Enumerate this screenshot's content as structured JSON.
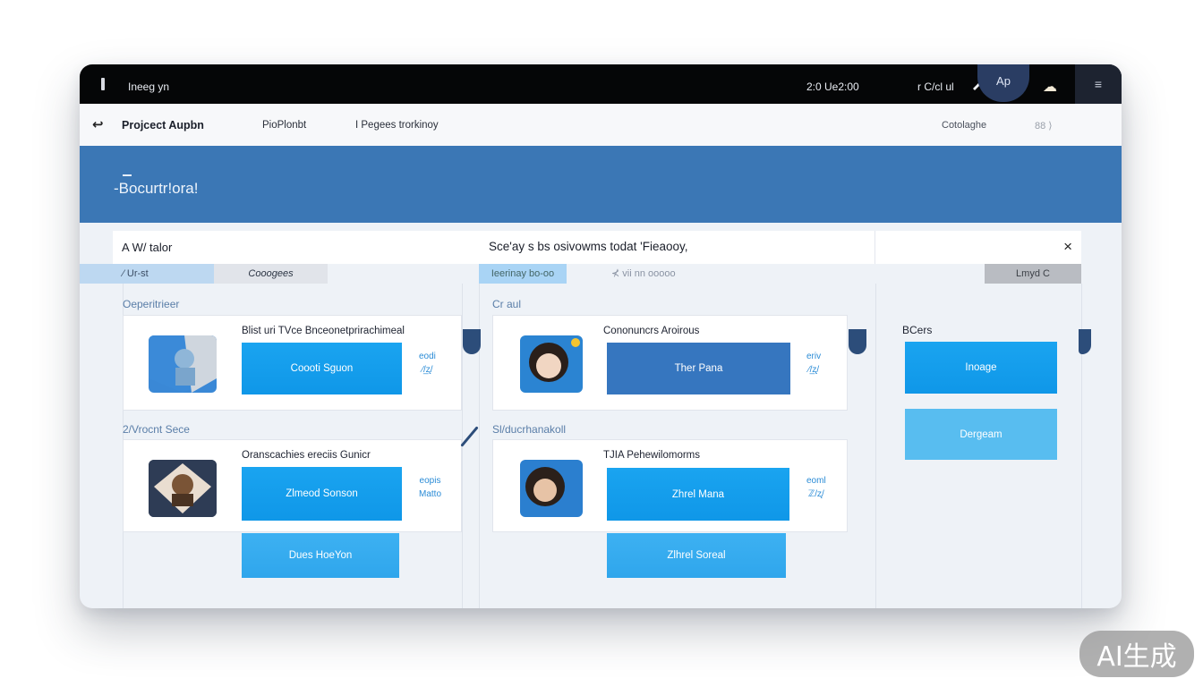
{
  "system_bar": {
    "app_name": "Ineeg yn",
    "clock": "2:0 Ue2:00",
    "status": "r C/cl ul",
    "avatar_label": "Ap",
    "menu_icon": "≡"
  },
  "nav": {
    "back_icon": "arrow-left-icon",
    "project": "Projcect Aupbn",
    "items": [
      "PioPlonbt",
      "I Pegees trorkinoy"
    ],
    "right_items": [
      "Cotolaghe",
      "88 ⟩"
    ]
  },
  "banner": {
    "title": "-Bocurtr!ora!"
  },
  "panel": {
    "left_label": "A W/ talor",
    "mid_label": "Sce'ay s bs osivowms todat 'Fieaooy,",
    "close_label": "×",
    "filters": [
      "⁄ Ur-st",
      "Cooogees",
      "Ieerinay bo-oo",
      "⊀ vii nn ooooo",
      "Lmyd C"
    ]
  },
  "columns": [
    {
      "sections": [
        {
          "label": "Oeperitrieer",
          "card": {
            "title": "Blist uri TVce Bnceonetprirachimeal",
            "button": "Coooti Sguon",
            "meta": [
              "eodi",
              "⁄/̲ʐ/"
            ]
          }
        },
        {
          "label": "2/Vrocnt Sece",
          "card": {
            "title": "Oranscachies ereciis Gunicr",
            "button": "Zlmeod Sonson",
            "meta": [
              "eopis",
              "Matto"
            ]
          },
          "extra_button": "Dues HoeYon"
        }
      ]
    },
    {
      "sections": [
        {
          "label": "Cr aul",
          "card": {
            "title": "Cononuncrs Aroirous",
            "button": "Ther Pana",
            "meta": [
              "eriv",
              "⁄/̲ʐ/"
            ]
          }
        },
        {
          "label": "Sl/ducrhanakoll",
          "card": {
            "title": "TJIA Pehewilomorms",
            "button": "Zhrel Mana",
            "meta": [
              "eoml",
              "ℤ/ʐ/"
            ]
          },
          "extra_button": "Zlhrel Soreal"
        }
      ]
    },
    {
      "label": "BCers",
      "buttons": [
        "Inoage",
        "Dergeam"
      ]
    }
  ],
  "watermark": "AI生成",
  "colors": {
    "accent": "#1aa4f0",
    "banner": "#3b77b5",
    "sysbar": "#050607",
    "dark_button": "#3676bf"
  }
}
